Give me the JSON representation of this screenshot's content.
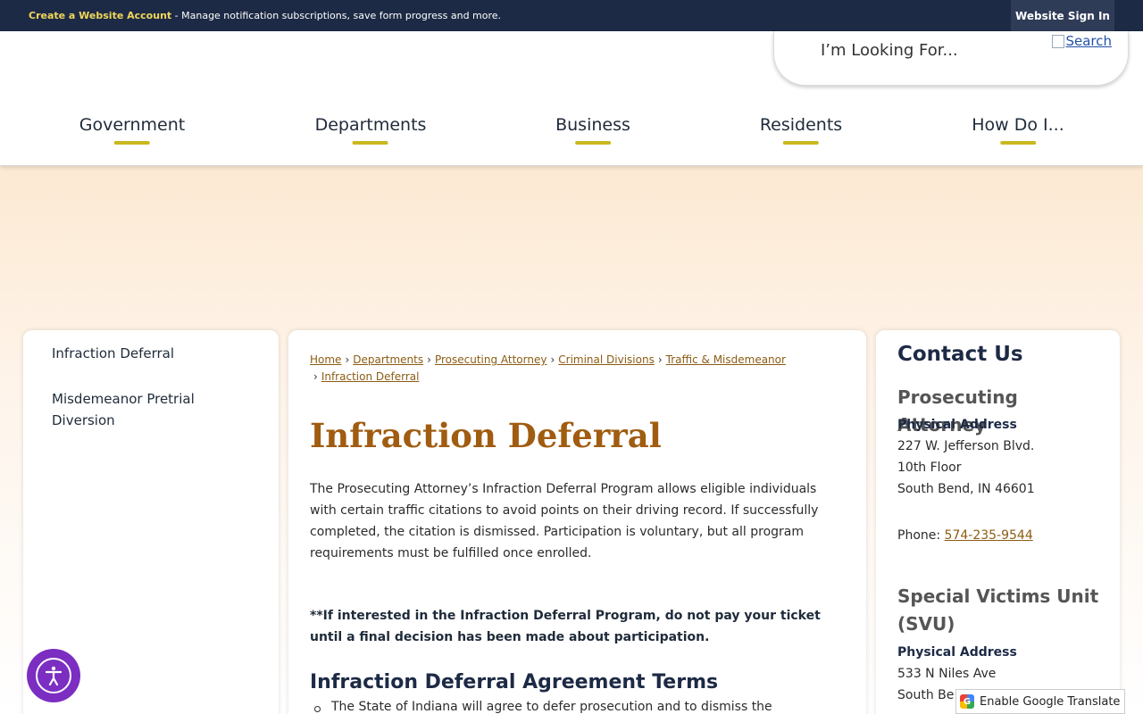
{
  "topbar": {
    "create_account_link": "Create a Website Account",
    "create_account_desc": " - Manage notification subscriptions, save form progress and more.",
    "signin_label": "Website Sign In"
  },
  "search": {
    "placeholder": "I’m Looking For...",
    "button_label": "Search"
  },
  "nav": {
    "items": [
      {
        "label": "Government"
      },
      {
        "label": "Departments"
      },
      {
        "label": "Business"
      },
      {
        "label": "Residents"
      },
      {
        "label": "How Do I..."
      }
    ],
    "underline_color": "#c8b81d"
  },
  "sidebar": {
    "items": [
      {
        "label": "Infraction Deferral"
      },
      {
        "label": "Misdemeanor Pretrial Diversion"
      }
    ]
  },
  "breadcrumb": {
    "items": [
      "Home",
      "Departments",
      "Prosecuting Attorney",
      "Criminal Divisions",
      "Traffic & Misdemeanor",
      "Infraction Deferral"
    ],
    "separator": "›"
  },
  "main": {
    "title": "Infraction Deferral",
    "intro": "The Prosecuting Attorney’s Infraction Deferral Program allows eligible individuals with certain traffic citations to avoid points on their driving record. If successfully completed, the citation is dismissed. Participation is voluntary, but all program requirements must be fulfilled once enrolled.",
    "note": "**If interested in the Infraction Deferral Program, do not pay your ticket until a final decision has been made about participation.",
    "section_heading": "Infraction Deferral Agreement Terms",
    "bullet_1": "The State of Indiana will agree to defer prosecution and to dismiss the"
  },
  "contact": {
    "heading": "Contact Us",
    "dept1": {
      "name": "Prosecuting Attorney",
      "address_label": "Physical Address",
      "address_lines": [
        "227 W. Jefferson Blvd.",
        "10th Floor",
        "South Bend, IN 46601"
      ],
      "phone_label": "Phone: ",
      "phone": "574-235-9544"
    },
    "dept2": {
      "name": "Special Victims Unit (SVU)",
      "address_label": "Physical Address",
      "address_lines": [
        "533 N Niles Ave",
        "South Be"
      ]
    }
  },
  "widgets": {
    "translate_label": "Enable Google Translate",
    "accessibility_icon": "accessibility-icon"
  },
  "colors": {
    "topbar": "#1d2a45",
    "title": "#a05c10",
    "link": "#8c5c14",
    "accessibility": "#7b2ec1"
  }
}
